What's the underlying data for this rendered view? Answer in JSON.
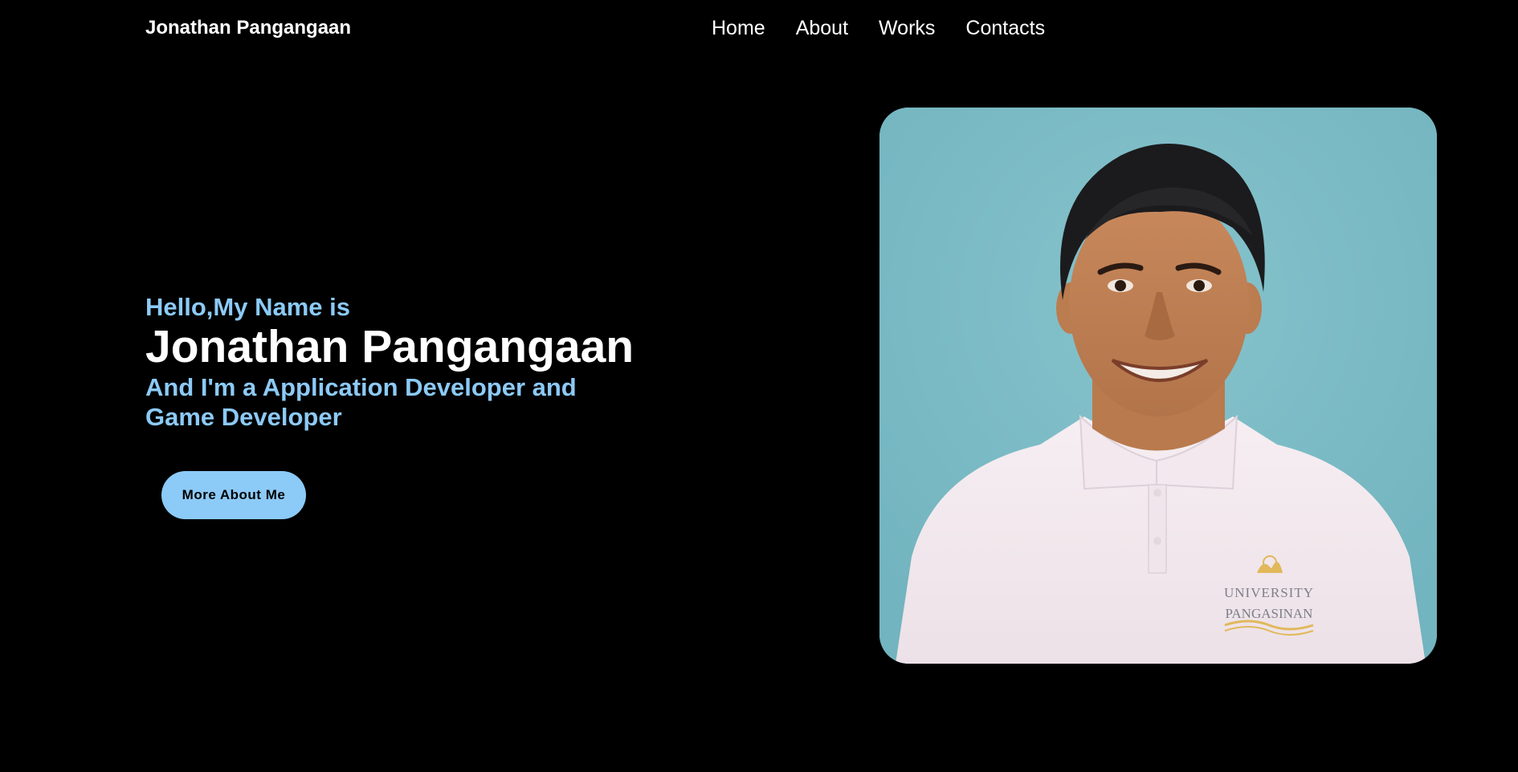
{
  "header": {
    "brand": "Jonathan Pangangaan",
    "nav": [
      {
        "label": "Home"
      },
      {
        "label": "About"
      },
      {
        "label": "Works"
      },
      {
        "label": "Contacts"
      }
    ]
  },
  "hero": {
    "greeting": "Hello,My Name is",
    "name": "Jonathan Pangangaan",
    "tagline": "And I'm a Application Developer and Game Developer",
    "cta_label": "More About Me"
  },
  "profile_photo": {
    "alt": "Jonathan Pangangaan",
    "shirt_logo": {
      "line1": "UNIVERSITY",
      "line2": "PANGASINAN"
    }
  },
  "colors": {
    "background": "#000000",
    "accent": "#8ccaf7",
    "text": "#ffffff",
    "photo_background": "#7ab9c4"
  }
}
